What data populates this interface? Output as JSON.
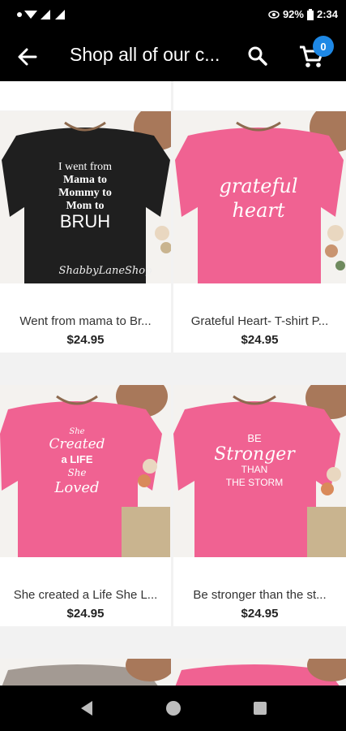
{
  "status_bar": {
    "battery": "92%",
    "time": "2:34"
  },
  "app_bar": {
    "title": "Shop all of our c...",
    "cart_count": "0"
  },
  "products": [
    {
      "name": "Went from mama to Br...",
      "price": "$24.95",
      "shirt_color": "#1f1f1f",
      "print_lines": [
        "I went from",
        "Mama to",
        "Mommy to",
        "Mom to",
        "BRUH"
      ],
      "watermark": "ShabbyLaneShop"
    },
    {
      "name": "Grateful Heart- T-shirt P...",
      "price": "$24.95",
      "shirt_color": "#f06292",
      "print_lines": [
        "grateful",
        "heart"
      ]
    },
    {
      "name": "She created a Life She L...",
      "price": "$24.95",
      "shirt_color": "#f06292",
      "print_lines": [
        "She",
        "Created",
        "a LIFE",
        "She",
        "Loved"
      ]
    },
    {
      "name": "Be stronger than the st...",
      "price": "$24.95",
      "shirt_color": "#f06292",
      "print_lines": [
        "BE",
        "Stronger",
        "THAN",
        "THE STORM"
      ]
    }
  ],
  "colors": {
    "bar": "#000000",
    "accent": "#1e88e5",
    "pink_shirt": "#f06292",
    "black_shirt": "#1f1f1f"
  }
}
